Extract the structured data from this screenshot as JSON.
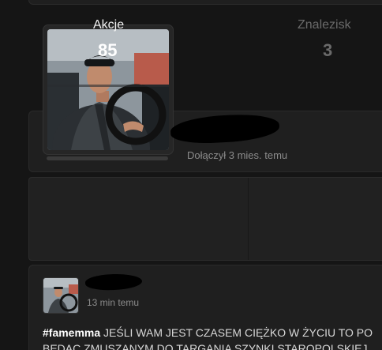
{
  "profile": {
    "joined_text": "Dołączył 3 mies. temu"
  },
  "stats": [
    {
      "label": "Akcje",
      "value": "85"
    },
    {
      "label": "Znalezisk",
      "value": "3"
    }
  ],
  "post": {
    "time": "13 min temu",
    "hashtag": "#famemma",
    "line1": " JEŚLI WAM JEST CZASEM CIĘŻKO W ŻYCIU TO PO",
    "line2": "BĘDĄC ZMUSZANYM DO TARGANIA SZYNKI STAROPOLSKIEJ"
  }
}
